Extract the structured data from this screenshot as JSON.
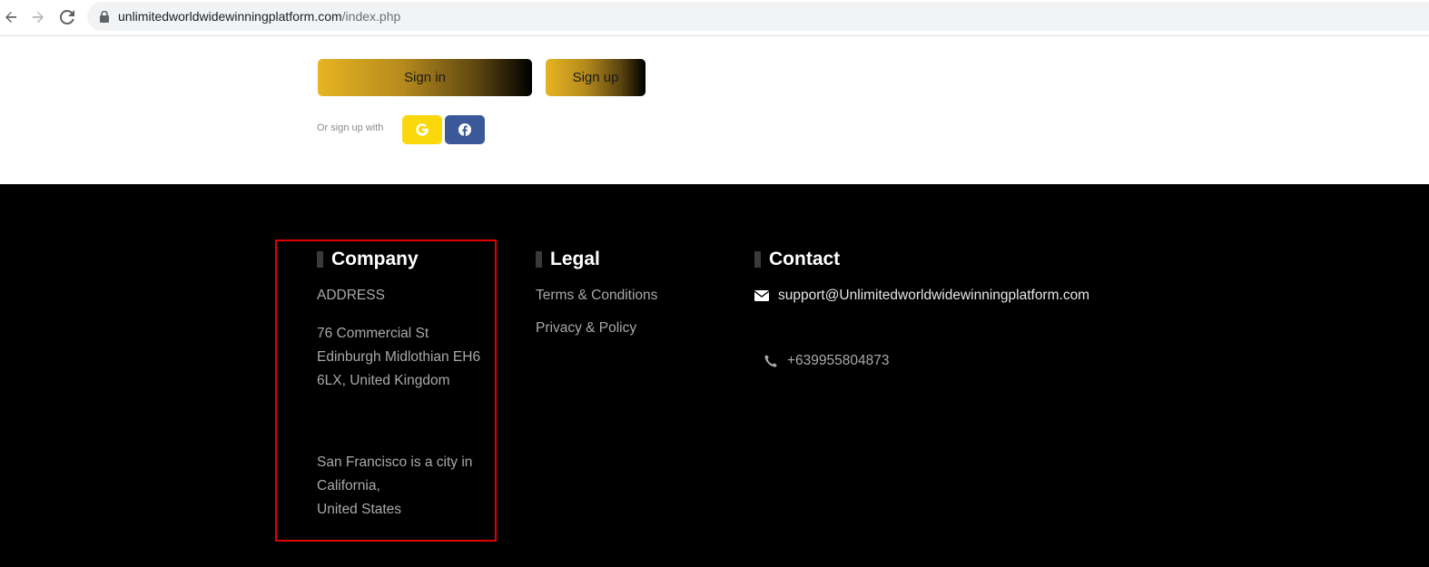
{
  "browser": {
    "url_domain": "unlimitedworldwidewinningplatform.com",
    "url_path": "/index.php"
  },
  "auth": {
    "signin_label": "Sign in",
    "signup_label": "Sign up",
    "or_label": "Or sign up with",
    "google_glyph": "G",
    "facebook_glyph": "f"
  },
  "footer": {
    "company": {
      "heading": "Company",
      "address_label": "ADDRESS",
      "address_lines": [
        "76 Commercial St",
        "Edinburgh Midlothian EH6",
        "6LX, United Kingdom"
      ],
      "city_lines": [
        "San Francisco is a city in",
        "California,",
        "United States"
      ]
    },
    "legal": {
      "heading": "Legal",
      "links": [
        "Terms & Conditions",
        "Privacy & Policy"
      ]
    },
    "contact": {
      "heading": "Contact",
      "email": "support@Unlimitedworldwidewinningplatform.com",
      "phone": "+639955804873"
    }
  },
  "colors": {
    "footer_bg": "#000000",
    "highlight_border": "#e00000",
    "google_bg": "#fbd80c",
    "facebook_bg": "#3b5998",
    "button_gradient_start": "#e6b422"
  },
  "icons": {
    "back": "arrow-left-icon",
    "forward": "arrow-right-icon",
    "reload": "reload-icon",
    "lock": "lock-icon",
    "email": "envelope-icon",
    "phone": "phone-icon",
    "google": "google-icon",
    "facebook": "facebook-icon"
  }
}
